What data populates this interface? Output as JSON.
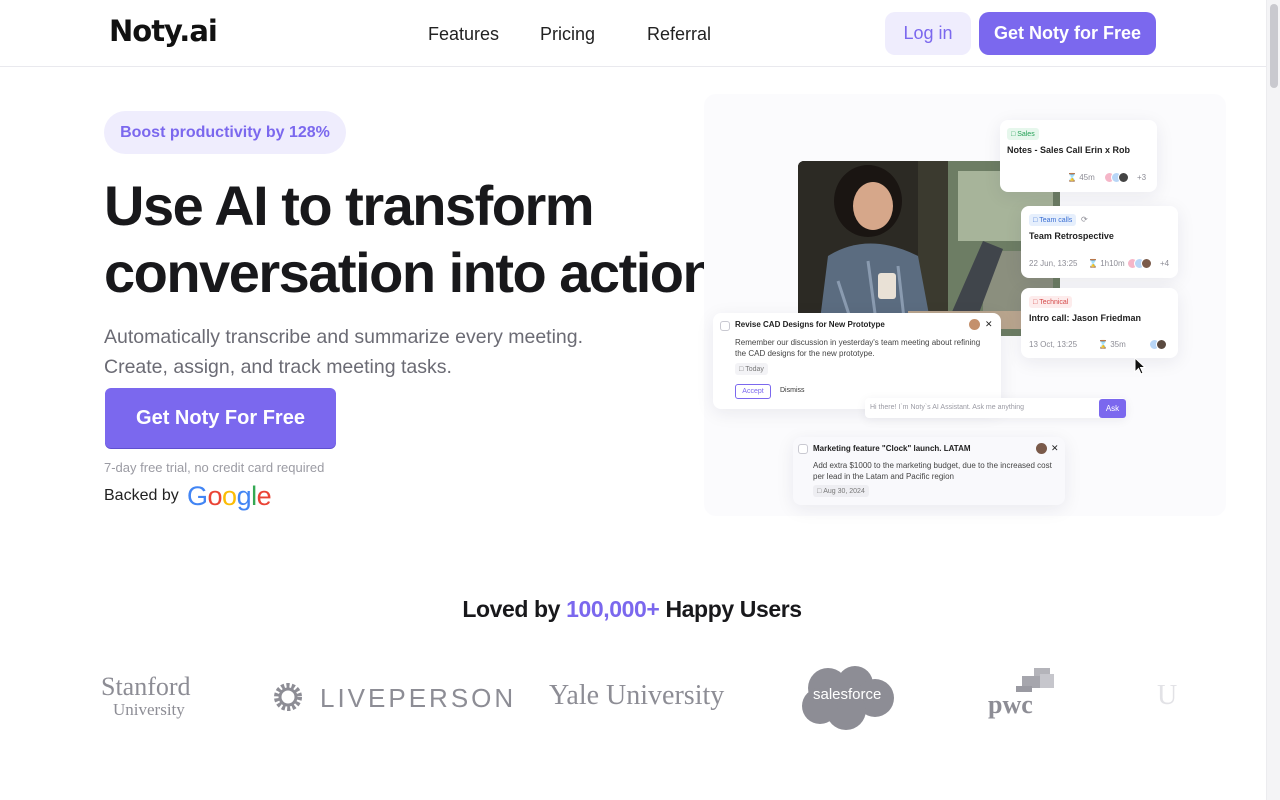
{
  "header": {
    "logo": "Noty.ai",
    "nav": [
      "Features",
      "Pricing",
      "Referral"
    ],
    "login_label": "Log in",
    "cta_label": "Get Noty for Free"
  },
  "hero": {
    "badge": "Boost productivity by 128%",
    "title_line1": "Use AI to transform",
    "title_line2": "conversation into action",
    "subtitle_line1": "Automatically transcribe and summarize every meeting.",
    "subtitle_line2": "Create, assign, and track meeting tasks.",
    "cta_label": "Get Noty For Free",
    "trial_note": "7-day free trial, no credit card required",
    "backed_by": "Backed by",
    "backer": "Google"
  },
  "mockup": {
    "meetings": [
      {
        "tag": "Sales",
        "title": "Notes - Sales Call Erin x Rob",
        "date": "",
        "duration": "45m",
        "extra": "+3"
      },
      {
        "tag": "Team calls",
        "title": "Team Retrospective",
        "date": "22 Jun, 13:25",
        "duration": "1h10m",
        "extra": "+4"
      },
      {
        "tag": "Technical",
        "title": "Intro call: Jason Friedman",
        "date": "13 Oct, 13:25",
        "duration": "35m",
        "extra": ""
      }
    ],
    "task1": {
      "title": "Revise CAD Designs for New Prototype",
      "body_line1": "Remember our discussion in yesterday's team meeting about refining",
      "body_line2": "the CAD designs for the new prototype.",
      "due": "Today",
      "accept": "Accept",
      "dismiss": "Dismiss"
    },
    "assistant_placeholder": "Hi there! I`m Noty`s AI Assistant. Ask me anything",
    "ask_label": "Ask",
    "task2": {
      "title": "Marketing feature \"Clock\" launch. LATAM",
      "body_line1": "Add extra $1000 to the marketing budget, due to the increased cost",
      "body_line2": "per lead in the Latam and Pacific region",
      "due": "Aug 30, 2024"
    }
  },
  "social": {
    "prefix": "Loved by",
    "highlight": "100,000+",
    "suffix": "Happy Users",
    "logos": {
      "stanford_1": "Stanford",
      "stanford_2": "University",
      "liveperson": "LIVEPERSON",
      "yale": "Yale University",
      "salesforce": "salesforce",
      "pwc": "pwc"
    }
  },
  "colors": {
    "accent": "#7b68ee",
    "accent_light": "#efedfd",
    "text_dark": "#18181b",
    "text_muted": "#6b6b74"
  }
}
